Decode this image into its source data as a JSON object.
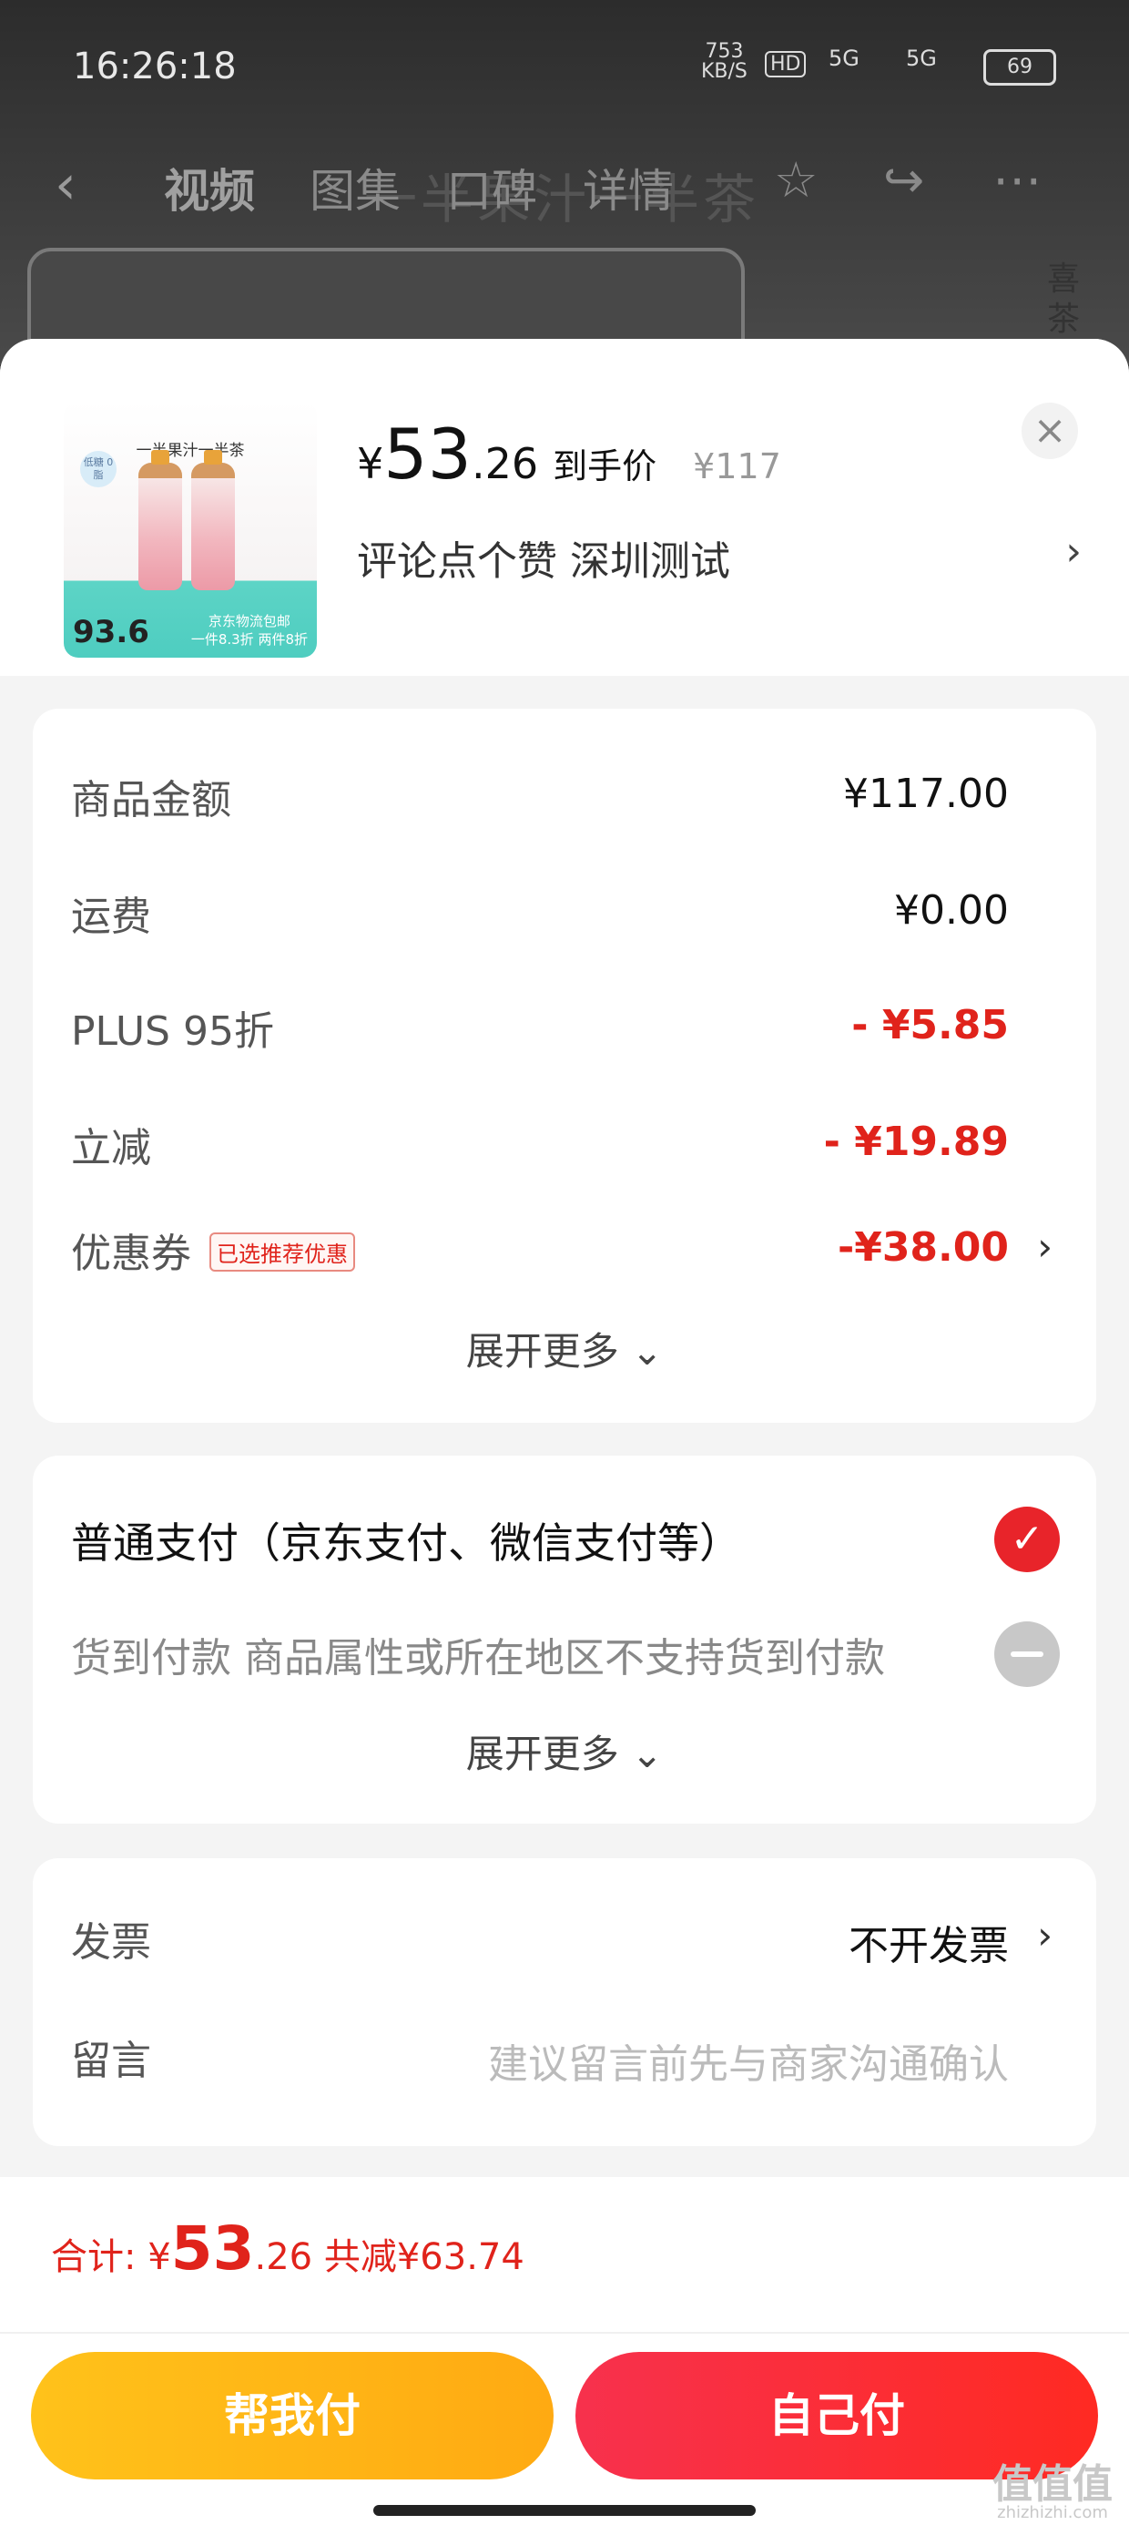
{
  "status_bar": {
    "time": "16:26:18",
    "net_speed_value": "753",
    "net_speed_unit": "KB/S",
    "hd": "HD",
    "signal_1": "5G",
    "signal_2": "5G",
    "battery": "69"
  },
  "nav": {
    "back_icon": "chevron-left-icon",
    "tabs": [
      "视频",
      "图集",
      "口碑",
      "详情"
    ],
    "active_tab": "视频",
    "ghost_title": "一半果汁一半茶",
    "icons": [
      "star-icon",
      "share-icon",
      "more-icon"
    ]
  },
  "background": {
    "side_text": "喜茶"
  },
  "product": {
    "thumbnail": {
      "title": "一半果汁一半茶",
      "badge": "低糖 0脂",
      "price": "93.6",
      "promo_line1": "京东物流包邮",
      "promo_line2": "一件8.3折 两件8折"
    },
    "price_symbol": "¥",
    "price_int": "53",
    "price_dec": ".26",
    "price_tag": "到手价",
    "original_price": "¥117",
    "spec": "评论点个赞  深圳测试"
  },
  "summary": {
    "rows": [
      {
        "label": "商品金额",
        "value": "¥117.00",
        "red": false
      },
      {
        "label": "运费",
        "value": "¥0.00",
        "red": false
      },
      {
        "label": "PLUS 95折",
        "value": "- ¥5.85",
        "red": true
      },
      {
        "label": "立减",
        "value": "- ¥19.89",
        "red": true
      },
      {
        "label": "优惠券",
        "value": "-¥38.00",
        "red": true
      }
    ],
    "coupon_tag": "已选推荐优惠",
    "expand_label": "展开更多"
  },
  "payment": {
    "options": [
      {
        "label": "普通支付（京东支付、微信支付等）",
        "selected": true
      },
      {
        "label": "货到付款 商品属性或所在地区不支持货到付款",
        "selected": false
      }
    ],
    "expand_label": "展开更多"
  },
  "extra": {
    "invoice_label": "发票",
    "invoice_value": "不开发票",
    "message_label": "留言",
    "message_placeholder": "建议留言前先与商家沟通确认"
  },
  "footer": {
    "total_prefix": "合计: ¥",
    "total_int": "53",
    "total_dec": ".26",
    "total_discount": "共减¥63.74",
    "help_pay_label": "帮我付",
    "self_pay_label": "自己付",
    "watermark": "值值值",
    "watermark_url": "zhizhizhi.com"
  },
  "colors": {
    "accent_red": "#e0231b",
    "help_pay_yellow": "#ffb814",
    "self_pay_red": "#f7314d"
  }
}
